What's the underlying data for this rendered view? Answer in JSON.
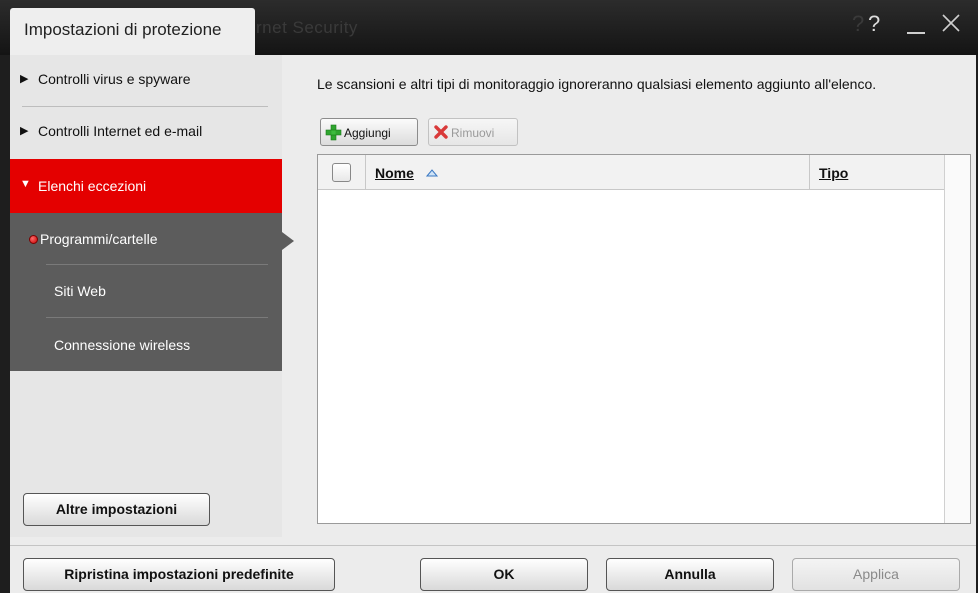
{
  "window": {
    "title": "Impostazioni di protezione",
    "ghost_title": "rnet Security",
    "help_label": "?",
    "help_ghost": "?",
    "minimize_label": "—",
    "close_label": "✕"
  },
  "sidebar": {
    "items": [
      {
        "label": "Controlli virus e spyware",
        "arrow": "▶"
      },
      {
        "label": "Controlli Internet ed e-mail",
        "arrow": "▶"
      },
      {
        "label": "Elenchi eccezioni",
        "arrow": "▼"
      }
    ],
    "subitems": [
      {
        "label": "Programmi/cartelle"
      },
      {
        "label": "Siti Web"
      },
      {
        "label": "Connessione wireless"
      }
    ],
    "more_settings": "Altre impostazioni"
  },
  "main": {
    "description": "Le scansioni e altri tipi di monitoraggio ignoreranno qualsiasi elemento aggiunto all'elenco.",
    "add_label": "Aggiungi",
    "remove_label": "Rimuovi",
    "columns": {
      "name": "Nome",
      "type": "Tipo"
    }
  },
  "footer": {
    "restore_defaults": "Ripristina impostazioni predefinite",
    "ok": "OK",
    "cancel": "Annulla",
    "apply": "Applica"
  },
  "colors": {
    "accent": "#e40000",
    "subpanel": "#5c5c5c"
  },
  "icons": [
    "help-icon",
    "minimize-icon",
    "close-icon",
    "plus-icon",
    "remove-x-icon",
    "sort-ascending-icon"
  ]
}
